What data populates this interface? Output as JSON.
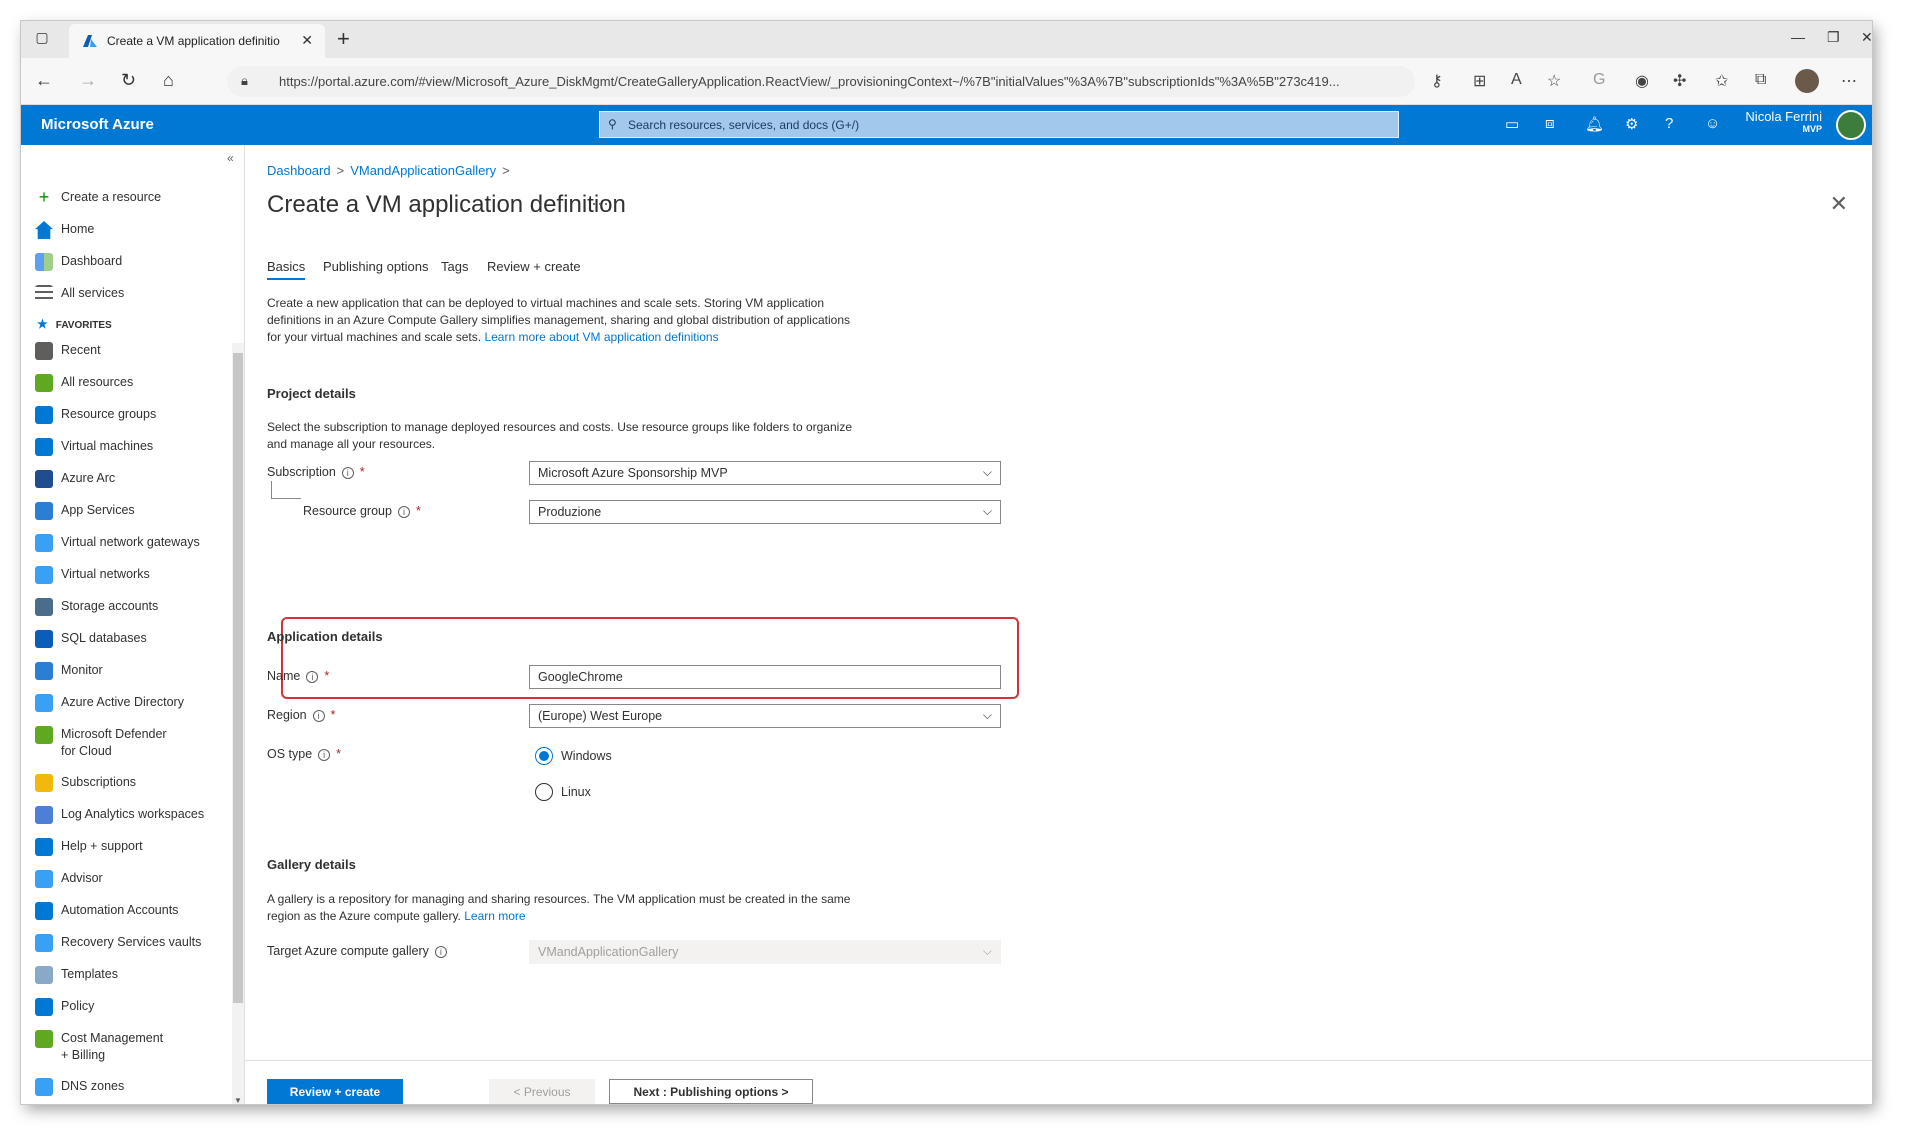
{
  "browser": {
    "tab_title": "Create a VM application definitio",
    "tab_close": "✕",
    "new_tab": "+",
    "url": "https://portal.azure.com/#view/Microsoft_Azure_DiskMgmt/CreateGalleryApplication.ReactView/_provisioningContext~/%7B\"initialValues\"%3A%7B\"subscriptionIds\"%3A%5B\"273c419..."
  },
  "azure": {
    "brand": "Microsoft Azure",
    "search_placeholder": "Search resources, services, and docs (G+/)",
    "user_name": "Nicola Ferrini",
    "user_role": "MVP"
  },
  "sidebar": {
    "favorites_label": "FAVORITES",
    "top_items": [
      {
        "label": "Create a resource",
        "icon": "plus-icon"
      },
      {
        "label": "Home",
        "icon": "home-icon"
      },
      {
        "label": "Dashboard",
        "icon": "dashboard-icon"
      },
      {
        "label": "All services",
        "icon": "list-icon"
      }
    ],
    "items": [
      {
        "label": "Recent",
        "icon": "clock-icon"
      },
      {
        "label": "All resources",
        "icon": "grid-icon"
      },
      {
        "label": "Resource groups",
        "icon": "resource-group-icon"
      },
      {
        "label": "Virtual machines",
        "icon": "vm-icon"
      },
      {
        "label": "Azure Arc",
        "icon": "arc-icon"
      },
      {
        "label": "App Services",
        "icon": "globe-icon"
      },
      {
        "label": "Virtual network gateways",
        "icon": "gateway-icon"
      },
      {
        "label": "Virtual networks",
        "icon": "vnet-icon"
      },
      {
        "label": "Storage accounts",
        "icon": "storage-icon"
      },
      {
        "label": "SQL databases",
        "icon": "sql-icon"
      },
      {
        "label": "Monitor",
        "icon": "monitor-icon"
      },
      {
        "label": "Azure Active Directory",
        "icon": "aad-icon"
      },
      {
        "label": "Microsoft Defender for Cloud",
        "icon": "shield-icon"
      },
      {
        "label": "Subscriptions",
        "icon": "key-icon"
      },
      {
        "label": "Log Analytics workspaces",
        "icon": "log-analytics-icon"
      },
      {
        "label": "Help + support",
        "icon": "support-icon"
      },
      {
        "label": "Advisor",
        "icon": "advisor-icon"
      },
      {
        "label": "Automation Accounts",
        "icon": "automation-icon"
      },
      {
        "label": "Recovery Services vaults",
        "icon": "cloud-icon"
      },
      {
        "label": "Templates",
        "icon": "template-icon"
      },
      {
        "label": "Policy",
        "icon": "policy-icon"
      },
      {
        "label": "Cost Management + Billing",
        "icon": "cost-icon"
      },
      {
        "label": "DNS zones",
        "icon": "dns-icon"
      }
    ]
  },
  "breadcrumb": [
    "Dashboard",
    "VMandApplicationGallery"
  ],
  "page_title": "Create a VM application definition",
  "tabs": [
    "Basics",
    "Publishing options",
    "Tags",
    "Review + create"
  ],
  "intro": {
    "text": "Create a new application that can be deployed to virtual machines and scale sets. Storing VM application definitions in an Azure Compute Gallery simplifies management, sharing and global distribution of applications for your virtual machines and scale sets.",
    "link": "Learn more about VM application definitions"
  },
  "project": {
    "heading": "Project details",
    "desc": "Select the subscription to manage deployed resources and costs. Use resource groups like folders to organize and manage all your resources.",
    "subscription_label": "Subscription",
    "subscription_value": "Microsoft Azure Sponsorship MVP",
    "rg_label": "Resource group",
    "rg_value": "Produzione"
  },
  "application": {
    "heading": "Application details",
    "name_label": "Name",
    "name_value": "GoogleChrome",
    "region_label": "Region",
    "region_value": "(Europe) West Europe",
    "os_label": "OS type",
    "os_windows": "Windows",
    "os_linux": "Linux"
  },
  "gallery": {
    "heading": "Gallery details",
    "desc": "A gallery is a repository for managing and sharing resources. The VM application must be created in the same region as the Azure compute gallery.",
    "link": "Learn more",
    "target_label": "Target Azure compute gallery",
    "target_value": "VMandApplicationGallery"
  },
  "footer": {
    "review": "Review + create",
    "previous": "< Previous",
    "next": "Next : Publishing options >"
  },
  "colors": {
    "accent": "#0078d4",
    "highlight": "#d1333a"
  }
}
